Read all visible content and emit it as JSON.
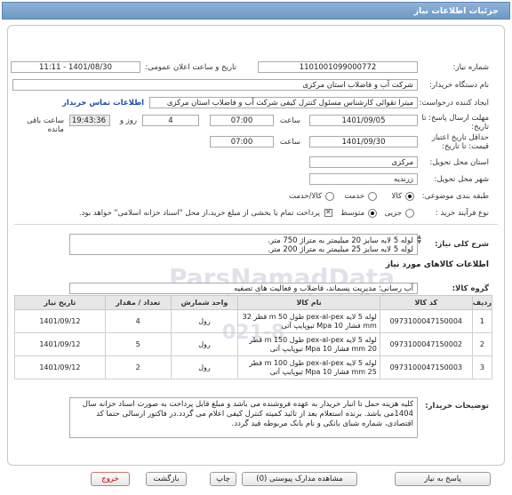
{
  "header": {
    "title": "جزئیات اطلاعات نیاز"
  },
  "form": {
    "need_number_label": "شماره نیاز:",
    "need_number": "1101001099000772",
    "announce_label": "تاریخ و ساعت اعلان عمومی:",
    "announce_value": "1401/08/30 - 11:11",
    "buyer_org_label": "نام دستگاه خریدار:",
    "buyer_org": "شرکت آب و فاضلاب استان مرکزی",
    "creator_label": "ایجاد کننده درخواست:",
    "creator": "میترا تقوائی کارشناس مسئول کنترل کیفی شرکت آب و فاضلاب استان مرکزی",
    "contact_link": "اطلاعات تماس خریدار",
    "deadline_label": "مهلت ارسال پاسخ: تا تاریخ:",
    "deadline_date": "1401/09/05",
    "time_label": "ساعت",
    "deadline_time": "07:00",
    "days_value": "4",
    "days_label": "روز و",
    "remaining_time": "19:43:36",
    "remaining_label": "ساعت باقی مانده",
    "validity_label": "حداقل تاریخ اعتبار قیمت: تا تاریخ:",
    "validity_date": "1401/09/30",
    "validity_time": "07:00",
    "province_label": "استان محل تحویل:",
    "province": "مرکزی",
    "city_label": "شهر محل تحویل:",
    "city": "زرندیه",
    "category_label": "طبقه بندی موضوعی:",
    "category_options": [
      "کالا",
      "خدمت",
      "کالا/خدمت"
    ],
    "process_label": "نوع فرآیند خرید :",
    "process_options": [
      "جزیی",
      "متوسط"
    ],
    "payment_note": "پرداخت تمام یا بخشی از مبلغ خرید،از محل \"اسناد خزانه اسلامی\" خواهد بود."
  },
  "description": {
    "label": "شرح کلی نیاز:",
    "lines": [
      "لوله 5 لایه سایز 20 میلیمتر به متراژ 750 متر.",
      "لوله 5 لایه سایز 25 میلیمتر به متراژ 200 متر."
    ]
  },
  "goods": {
    "section_title": "اطلاعات کالاهای مورد نیاز",
    "group_label": "گروه کالا:",
    "group_value": "آب رسانی؛ مدیریت پسماند، فاضلاب و فعالیت های تصفیه",
    "columns": [
      "ردیف",
      "کد کالا",
      "نام کالا",
      "واحد شمارش",
      "تعداد / مقدار",
      "تاریخ نیاز"
    ],
    "rows": [
      {
        "idx": "1",
        "code": "0973100047150004",
        "name": "لوله 5 لایه pex-al-pex طول 50 m قطر 32 mm فشار 10 Mpa تیوپایپ آتی",
        "unit": "رول",
        "qty": "4",
        "date": "1401/09/12"
      },
      {
        "idx": "2",
        "code": "0973100047150002",
        "name": "لوله 5 لایه pex-al-pex طول 150 m قطر 20 mm فشار 10 Mpa تیوپایپ آتی",
        "unit": "رول",
        "qty": "5",
        "date": "1401/09/12"
      },
      {
        "idx": "3",
        "code": "0973100047150003",
        "name": "لوله 5 لایه pex-al-pex طول 100 m قطر 25 mm فشار 10 Mpa تیوپایپ آتی",
        "unit": "رول",
        "qty": "2",
        "date": "1401/09/12"
      }
    ]
  },
  "notes": {
    "label": "توضیحات خریدار:",
    "text": "کلیه هزینه حمل تا انبار خریدار به عهده فروشنده می باشد و مبلغ قابل پرداخت به صورت اسناد خزانه سال 1404می باشد. برنده استعلام بعد از تائید کمیته کنترل کیفی اعلام می گردد.در فاکتور ارسالی حتما کد اقتصادی، شماره شبای بانکی و نام بانک مربوطه قید گردد."
  },
  "buttons": {
    "reply": "پاسخ به نیاز",
    "attachments": "مشاهده مدارک پیوستی (0)",
    "print": "چاپ",
    "back": "بازگشت",
    "exit": "خروج"
  },
  "watermark": {
    "main": "ParsNamadData",
    "sub": "پایگاه ارسانی مناقصات",
    "num": "021-8"
  },
  "colors": {
    "header": "#6d97c4",
    "timer_bg": "#ececec",
    "exit_text": "#c00000"
  }
}
